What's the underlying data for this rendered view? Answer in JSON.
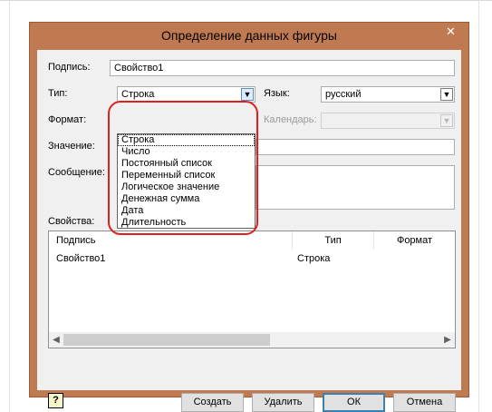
{
  "window": {
    "title": "Определение данных фигуры",
    "close_symbol": "✕"
  },
  "form": {
    "caption_label": "Подпись:",
    "caption_value": "Свойство1",
    "type_label": "Тип:",
    "type_value": "Строка",
    "language_label": "Язык:",
    "language_value": "русский",
    "format_label": "Формат:",
    "calendar_label": "Календарь:",
    "value_label": "Значение:",
    "message_label": "Сообщение:"
  },
  "type_dropdown": {
    "options": [
      "Строка",
      "Число",
      "Постоянный список",
      "Переменный список",
      "Логическое значение",
      "Денежная сумма",
      "Дата",
      "Длительность"
    ],
    "selected_index": 0
  },
  "properties": {
    "label": "Свойства:",
    "columns": [
      "Подпись",
      "Тип",
      "Формат"
    ],
    "rows": [
      {
        "caption": "Свойство1",
        "type": "Строка",
        "format": ""
      }
    ]
  },
  "buttons": {
    "help": "?",
    "create": "Создать",
    "delete": "Удалить",
    "ok": "ОК",
    "cancel": "Отмена"
  },
  "icons": {
    "close": "close-icon",
    "dropdown": "chevron-down-icon",
    "scroll_left": "scroll-left-icon",
    "scroll_right": "scroll-right-icon",
    "help": "help-icon"
  },
  "colors": {
    "title_bar": "#c07a52",
    "highlight": "#e0201e",
    "client": "#f0f0f0"
  }
}
